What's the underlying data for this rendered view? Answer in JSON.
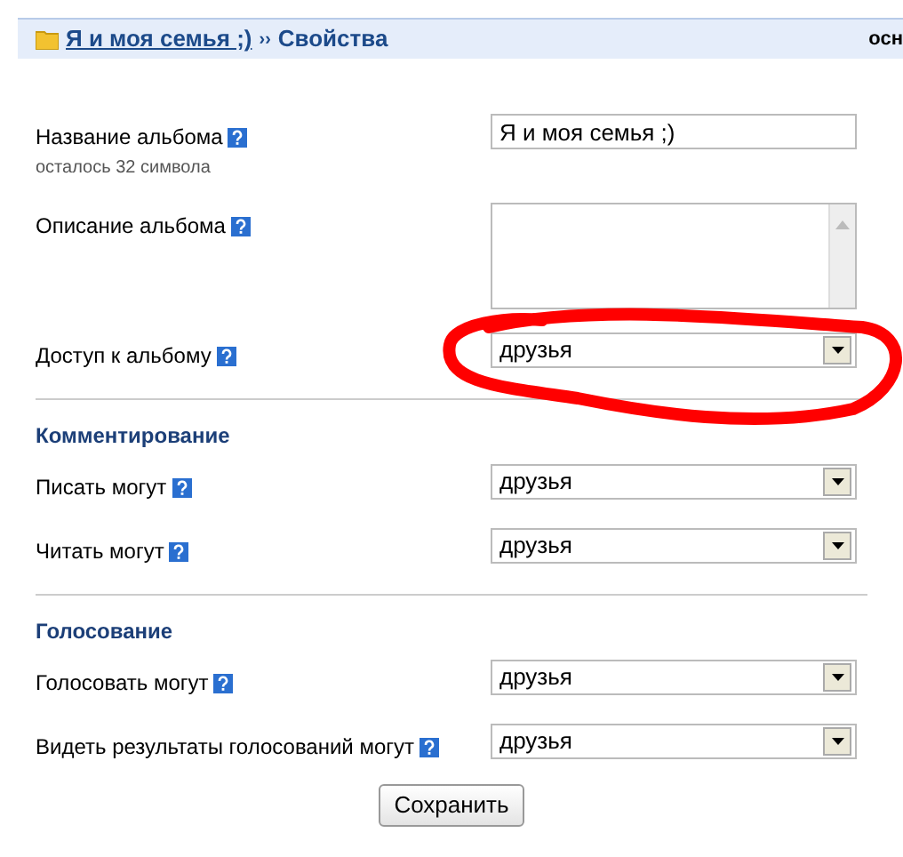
{
  "header": {
    "album_link": "Я и моя семья ;)",
    "separator": "››",
    "current": "Свойства",
    "right_text": "осн"
  },
  "fields": [
    {
      "kind": "text",
      "label": "Название альбома",
      "hint": "осталось 32 символа",
      "value": "Я и моя семья ;)",
      "highlighted": false
    },
    {
      "kind": "textarea",
      "label": "Описание альбома",
      "highlighted": false
    },
    {
      "kind": "select",
      "label": "Доступ к альбому",
      "value": "друзья",
      "highlighted": true
    }
  ],
  "sections": [
    {
      "title": "Комментирование",
      "fields": [
        {
          "kind": "select",
          "label": "Писать могут",
          "value": "друзья",
          "highlighted": false
        },
        {
          "kind": "select",
          "label": "Читать могут",
          "value": "друзья",
          "highlighted": false
        }
      ]
    },
    {
      "title": "Голосование",
      "fields": [
        {
          "kind": "select",
          "label": "Голосовать могут",
          "value": "друзья",
          "highlighted": false
        },
        {
          "kind": "select",
          "label": "Видеть результаты голосований могут",
          "value": "друзья",
          "highlighted": false
        }
      ]
    }
  ],
  "save_button": "Сохранить"
}
